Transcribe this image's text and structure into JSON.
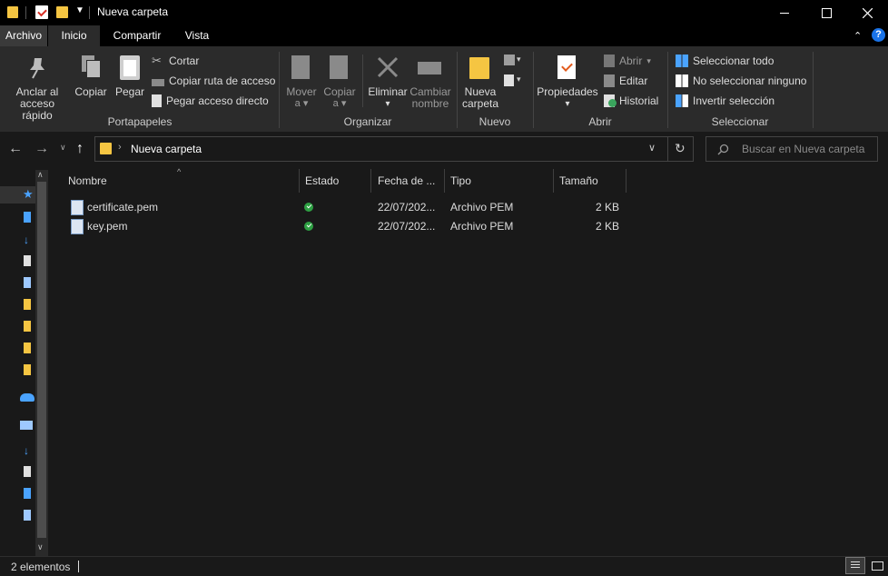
{
  "window": {
    "title": "Nueva carpeta"
  },
  "tabs": [
    {
      "label": "Archivo"
    },
    {
      "label": "Inicio"
    },
    {
      "label": "Compartir"
    },
    {
      "label": "Vista"
    }
  ],
  "ribbon": {
    "portapapeles": {
      "group_label": "Portapapeles",
      "pin": "Anclar al",
      "pin2": "acceso rápido",
      "copy": "Copiar",
      "paste": "Pegar",
      "cut": "Cortar",
      "copy_path": "Copiar ruta de acceso",
      "paste_shortcut": "Pegar acceso directo"
    },
    "organizar": {
      "group_label": "Organizar",
      "move": "Mover",
      "move2": "a",
      "copy_to": "Copiar",
      "copy_to2": "a",
      "delete": "Eliminar",
      "rename": "Cambiar",
      "rename2": "nombre"
    },
    "nuevo": {
      "group_label": "Nuevo",
      "new_folder": "Nueva",
      "new_folder2": "carpeta"
    },
    "abrir": {
      "group_label": "Abrir",
      "properties": "Propiedades",
      "open": "Abrir",
      "edit": "Editar",
      "history": "Historial"
    },
    "seleccionar": {
      "group_label": "Seleccionar",
      "select_all": "Seleccionar todo",
      "select_none": "No seleccionar ninguno",
      "invert": "Invertir selección"
    }
  },
  "address": {
    "path": "Nueva carpeta",
    "search_placeholder": "Buscar en Nueva carpeta"
  },
  "columns": [
    {
      "label": "Nombre"
    },
    {
      "label": "Estado"
    },
    {
      "label": "Fecha de ..."
    },
    {
      "label": "Tipo"
    },
    {
      "label": "Tamaño"
    }
  ],
  "files": [
    {
      "name": "certificate.pem",
      "date": "22/07/202...",
      "type": "Archivo PEM",
      "size": "2 KB"
    },
    {
      "name": "key.pem",
      "date": "22/07/202...",
      "type": "Archivo PEM",
      "size": "2 KB"
    }
  ],
  "status": {
    "count": "2 elementos"
  },
  "colors": {
    "folder": "#f5c542",
    "accent": "#1a73e8",
    "status_ok": "#2ea043"
  },
  "icons": {
    "search": "search-icon",
    "back": "back-arrow-icon",
    "forward": "forward-arrow-icon",
    "up": "up-arrow-icon",
    "refresh": "refresh-icon",
    "help": "help-icon"
  }
}
